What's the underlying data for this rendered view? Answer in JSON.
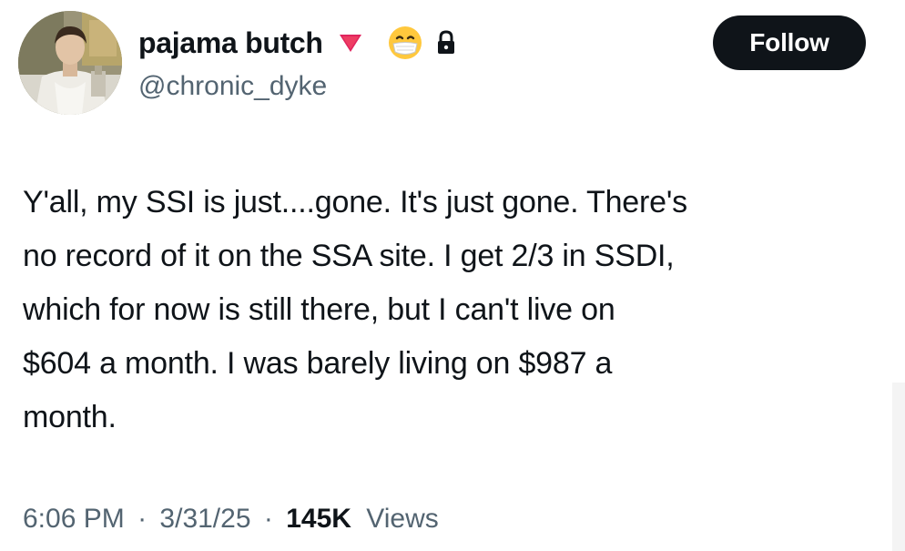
{
  "author": {
    "display_name": "pajama butch",
    "handle": "@chronic_dyke",
    "badges": [
      "red-triangle-down-icon",
      "mask-face-emoji-icon",
      "lock-icon"
    ]
  },
  "follow_button": {
    "label": "Follow"
  },
  "tweet": {
    "lines": [
      "Y'all, my SSI is just....gone. It's just gone. There's",
      "no record of it on the SSA site. I get 2/3 in SSDI,",
      "which for now is still there, but I can't live on",
      "$604 a month. I was barely living on $987 a",
      "month."
    ]
  },
  "meta": {
    "time": "6:06 PM",
    "separator": "·",
    "date": "3/31/25",
    "views_count": "145K",
    "views_label": "Views"
  },
  "colors": {
    "text_primary": "#0f1419",
    "text_secondary": "#536471",
    "follow_bg": "#0f1419",
    "badge_red": "#e0245e"
  }
}
